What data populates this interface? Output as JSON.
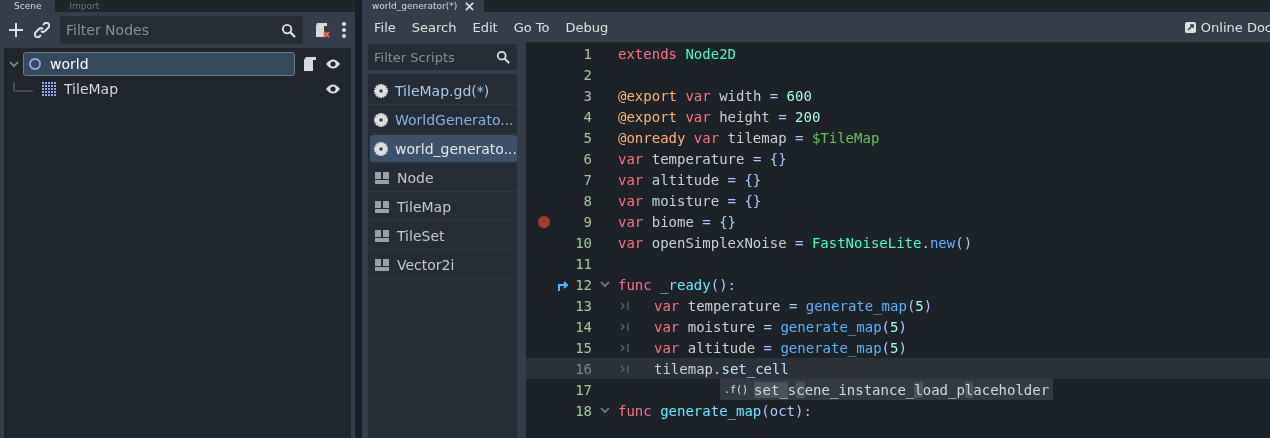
{
  "scene_dock": {
    "tabs": [
      {
        "label": "Scene",
        "selected": true
      },
      {
        "label": "Import",
        "selected": false
      }
    ],
    "filter": {
      "placeholder": "Filter Nodes"
    },
    "tree": [
      {
        "name": "world",
        "kind": "node2d",
        "selected": true,
        "expanded": true,
        "has_script": true,
        "visible": true,
        "children": [
          {
            "name": "TileMap",
            "kind": "tilemap",
            "selected": false,
            "has_script": false,
            "visible": true
          }
        ]
      }
    ]
  },
  "script_editor": {
    "tabs": [
      {
        "label": "world_generator(*)",
        "selected": true
      }
    ],
    "menu": [
      "File",
      "Search",
      "Edit",
      "Go To",
      "Debug"
    ],
    "online_docs": "Online Doc",
    "script_filter": {
      "placeholder": "Filter Scripts"
    },
    "scripts": [
      {
        "name": "TileMap.gd(*)",
        "kind": "script",
        "selected": false,
        "color": "#a9c9ec"
      },
      {
        "name": "WorldGenerato...",
        "kind": "script",
        "selected": false,
        "color": "#7fb2ea"
      },
      {
        "name": "world_generato...",
        "kind": "script",
        "selected": true,
        "color": "#e6e8ea"
      },
      {
        "name": "Node",
        "kind": "doc",
        "selected": false,
        "color": "#c5c8cc"
      },
      {
        "name": "TileMap",
        "kind": "doc",
        "selected": false,
        "color": "#c5c8cc"
      },
      {
        "name": "TileSet",
        "kind": "doc",
        "selected": false,
        "color": "#c5c8cc"
      },
      {
        "name": "Vector2i",
        "kind": "doc",
        "selected": false,
        "color": "#c5c8cc"
      }
    ],
    "lines": [
      {
        "n": "1",
        "breakpoint": false,
        "jump": false,
        "fold": false,
        "current": false,
        "tokens": [
          {
            "t": "extends",
            "kind": "kw"
          },
          {
            "t": " Node2D",
            "kind": "type"
          }
        ]
      },
      {
        "n": "2",
        "breakpoint": false,
        "jump": false,
        "fold": false,
        "current": false
      },
      {
        "n": "3",
        "breakpoint": false,
        "jump": false,
        "fold": false,
        "current": false,
        "tokens": [
          {
            "t": "@export",
            "kind": "ann"
          },
          {
            "t": " var",
            "kind": "kw"
          },
          {
            "t": " width"
          },
          {
            "t": " =",
            "kind": "sym"
          },
          {
            "t": " 600",
            "kind": "num"
          }
        ]
      },
      {
        "n": "4",
        "breakpoint": false,
        "jump": false,
        "fold": false,
        "current": false,
        "tokens": [
          {
            "t": "@export",
            "kind": "ann"
          },
          {
            "t": " var",
            "kind": "kw"
          },
          {
            "t": " height"
          },
          {
            "t": " =",
            "kind": "sym"
          },
          {
            "t": " 200",
            "kind": "num"
          }
        ]
      },
      {
        "n": "5",
        "breakpoint": false,
        "jump": false,
        "fold": false,
        "current": false,
        "tokens": [
          {
            "t": "@onready",
            "kind": "ann"
          },
          {
            "t": " var",
            "kind": "kw"
          },
          {
            "t": " tilemap"
          },
          {
            "t": " =",
            "kind": "sym"
          },
          {
            "t": " $TileMap",
            "kind": "node"
          }
        ]
      },
      {
        "n": "6",
        "breakpoint": false,
        "jump": false,
        "fold": false,
        "current": false,
        "tokens": [
          {
            "t": "var",
            "kind": "kw"
          },
          {
            "t": " temperature"
          },
          {
            "t": " = {}",
            "kind": "sym"
          }
        ]
      },
      {
        "n": "7",
        "breakpoint": false,
        "jump": false,
        "fold": false,
        "current": false,
        "tokens": [
          {
            "t": "var",
            "kind": "kw"
          },
          {
            "t": " altitude"
          },
          {
            "t": " = {}",
            "kind": "sym"
          }
        ]
      },
      {
        "n": "8",
        "breakpoint": false,
        "jump": false,
        "fold": false,
        "current": false,
        "tokens": [
          {
            "t": "var",
            "kind": "kw"
          },
          {
            "t": " moisture"
          },
          {
            "t": " = {}",
            "kind": "sym"
          }
        ]
      },
      {
        "n": "9",
        "breakpoint": true,
        "jump": false,
        "fold": false,
        "current": false,
        "tokens": [
          {
            "t": "var",
            "kind": "kw"
          },
          {
            "t": " biome"
          },
          {
            "t": " = {}",
            "kind": "sym"
          }
        ]
      },
      {
        "n": "10",
        "breakpoint": false,
        "jump": false,
        "fold": false,
        "current": false,
        "tokens": [
          {
            "t": "var",
            "kind": "kw"
          },
          {
            "t": " openSimplexNoise"
          },
          {
            "t": " =",
            "kind": "sym"
          },
          {
            "t": " FastNoiseLite",
            "kind": "type"
          },
          {
            "t": ".",
            "kind": "sym"
          },
          {
            "t": "new",
            "kind": "func"
          },
          {
            "t": "()",
            "kind": "sym"
          }
        ]
      },
      {
        "n": "11",
        "breakpoint": false,
        "jump": false,
        "fold": false,
        "current": false
      },
      {
        "n": "12",
        "breakpoint": false,
        "jump": true,
        "fold": true,
        "current": false,
        "tokens": [
          {
            "t": "func",
            "kind": "kw"
          },
          {
            "t": " _ready",
            "kind": "fname"
          },
          {
            "t": "():",
            "kind": "sym"
          }
        ]
      },
      {
        "n": "13",
        "breakpoint": false,
        "jump": false,
        "fold": false,
        "current": false,
        "tokens": [
          {
            "kind": "tab"
          },
          {
            "t": "var",
            "kind": "kw"
          },
          {
            "t": " temperature"
          },
          {
            "t": " =",
            "kind": "sym"
          },
          {
            "t": " generate_map",
            "kind": "func"
          },
          {
            "t": "(",
            "kind": "sym"
          },
          {
            "t": "5",
            "kind": "num"
          },
          {
            "t": ")",
            "kind": "sym"
          }
        ]
      },
      {
        "n": "14",
        "breakpoint": false,
        "jump": false,
        "fold": false,
        "current": false,
        "tokens": [
          {
            "kind": "tab"
          },
          {
            "t": "var",
            "kind": "kw"
          },
          {
            "t": " moisture"
          },
          {
            "t": " =",
            "kind": "sym"
          },
          {
            "t": " generate_map",
            "kind": "func"
          },
          {
            "t": "(",
            "kind": "sym"
          },
          {
            "t": "5",
            "kind": "num"
          },
          {
            "t": ")",
            "kind": "sym"
          }
        ]
      },
      {
        "n": "15",
        "breakpoint": false,
        "jump": false,
        "fold": false,
        "current": false,
        "tokens": [
          {
            "kind": "tab"
          },
          {
            "t": "var",
            "kind": "kw"
          },
          {
            "t": " altitude"
          },
          {
            "t": " =",
            "kind": "sym"
          },
          {
            "t": " generate_map",
            "kind": "func"
          },
          {
            "t": "(",
            "kind": "sym"
          },
          {
            "t": "5",
            "kind": "num"
          },
          {
            "t": ")",
            "kind": "sym"
          }
        ]
      },
      {
        "n": "16",
        "breakpoint": false,
        "jump": false,
        "fold": false,
        "current": true,
        "tokens": [
          {
            "kind": "tab"
          },
          {
            "t": "tilemap"
          },
          {
            "t": ".",
            "kind": "sym"
          },
          {
            "t": "set_cell",
            "kind": "prop"
          }
        ],
        "completion": {
          "badge": ".f()",
          "parts": [
            {
              "t": "set_",
              "match": true
            },
            {
              "t": "s",
              "match": false
            },
            {
              "t": "c",
              "match": true
            },
            {
              "t": "ene_instance_",
              "match": false
            },
            {
              "t": "l",
              "match": true
            },
            {
              "t": "oad_p",
              "match": false
            },
            {
              "t": "l",
              "match": true
            },
            {
              "t": "aceholder",
              "match": false
            }
          ]
        }
      },
      {
        "n": "17",
        "breakpoint": false,
        "jump": false,
        "fold": false,
        "current": false
      },
      {
        "n": "18",
        "breakpoint": false,
        "jump": false,
        "fold": true,
        "current": false,
        "tokens": [
          {
            "t": "func",
            "kind": "kw"
          },
          {
            "t": " generate_map",
            "kind": "fname"
          },
          {
            "t": "(oct):",
            "kind": "sym"
          }
        ]
      }
    ]
  }
}
